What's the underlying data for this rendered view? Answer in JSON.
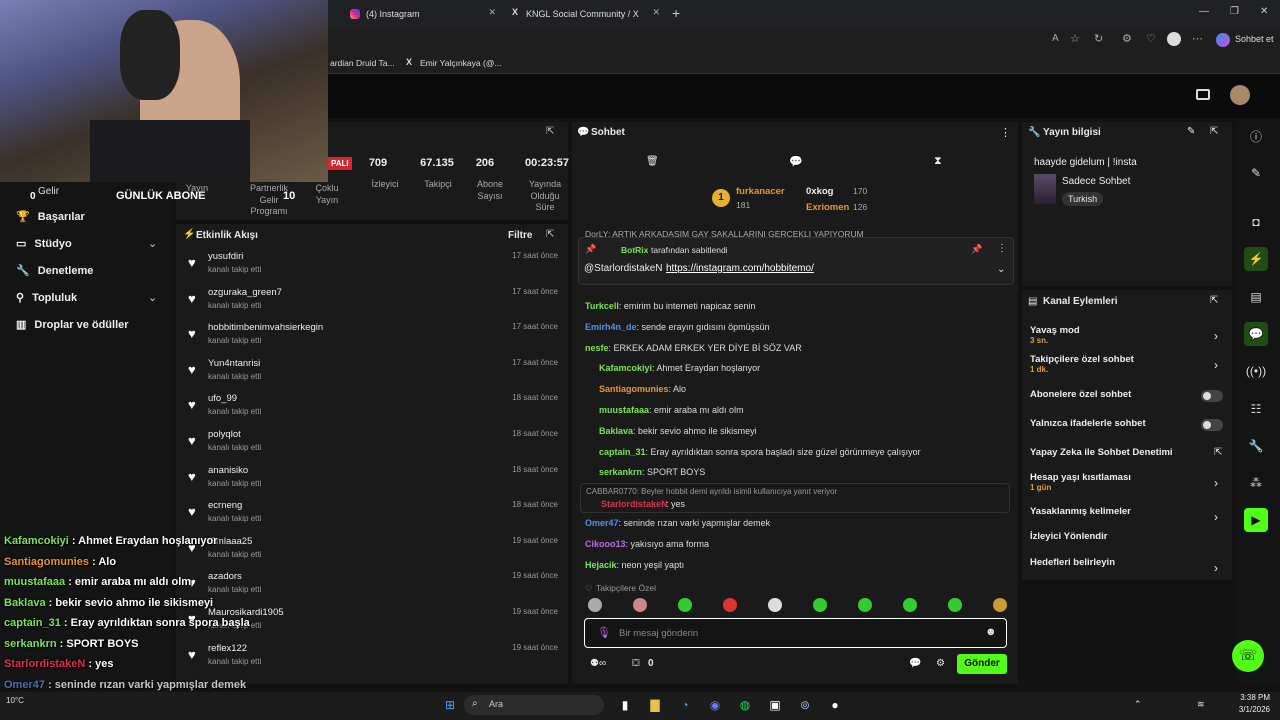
{
  "browser": {
    "tabs": [
      "(4) Instagram",
      "KNGL Social Community / X"
    ],
    "profile_label": "Sohbet et",
    "bookmarks": [
      "ardian Druid Ta...",
      "Emir Yalçınkaya (@..."
    ]
  },
  "overlay": {
    "gelir_label": "Gelir",
    "gelir_value": "0",
    "gunluk_abone": "GÜNLÜK ABONE",
    "gunluk_value": "10",
    "chat": [
      {
        "user": "Kafamcokiyi",
        "text": " : Ahmet Eraydan hoşlanıyor",
        "color": "#7be35a"
      },
      {
        "user": "Santiagomunies",
        "text": " : Alo",
        "color": "#e8962e"
      },
      {
        "user": "muustafaaa",
        "text": " : emir araba mı aldı olm",
        "color": "#7be35a"
      },
      {
        "user": "Baklava",
        "text": " : bekir sevio ahmo ile sikismeyi",
        "color": "#7be35a"
      },
      {
        "user": "captain_31",
        "text": " : Eray ayrıldıktan sonra spora başla",
        "color": "#7be35a"
      },
      {
        "user": "serkankrn",
        "text": " : SPORT BOYS",
        "color": "#7be35a"
      },
      {
        "user": "StarlordistakeN",
        "text": " : yes",
        "color": "#e0314b"
      },
      {
        "user": "Omer47",
        "text": " : seninde rızan varki yapmışlar demek",
        "color": "#5a8fe3"
      },
      {
        "user": "Cikooo13",
        "text": " : yakısıyo ama forma",
        "color": "#c06be3"
      }
    ]
  },
  "sidebar": {
    "items": [
      {
        "label": "Başarılar"
      },
      {
        "label": "Stüdyo"
      },
      {
        "label": "Denetleme"
      },
      {
        "label": "Topluluk"
      },
      {
        "label": "Droplar ve ödüller"
      }
    ]
  },
  "stats": {
    "badge": "PALI",
    "items": [
      {
        "value": "709",
        "label": "İzleyici"
      },
      {
        "value": "67.135",
        "label": "Takipçi"
      },
      {
        "value": "206",
        "label": "Abone Sayısı"
      },
      {
        "value": "00:23:57",
        "label": "Yayında Olduğu Süre"
      }
    ],
    "hidden_labels": [
      "Yayın",
      "Partnerlik Gelir Programı",
      "Çoklu Yayın"
    ]
  },
  "activity": {
    "title": "Etkinlik Akışı",
    "filter_label": "Filtre",
    "subtitle": "kanalı takip etti",
    "rows": [
      {
        "name": "yusufdiri",
        "time": "17 saat önce"
      },
      {
        "name": "ozguraka_green7",
        "time": "17 saat önce"
      },
      {
        "name": "hobbitimbenimvahsierkegin",
        "time": "17 saat önce"
      },
      {
        "name": "Yun4ntanrisi",
        "time": "17 saat önce"
      },
      {
        "name": "ufo_99",
        "time": "18 saat önce"
      },
      {
        "name": "polyqlot",
        "time": "18 saat önce"
      },
      {
        "name": "ananisiko",
        "time": "18 saat önce"
      },
      {
        "name": "ecrneng",
        "time": "18 saat önce"
      },
      {
        "name": "t3mlaaa25",
        "time": "19 saat önce"
      },
      {
        "name": "azadors",
        "time": "19 saat önce"
      },
      {
        "name": "Maurosikardi1905",
        "time": "19 saat önce"
      },
      {
        "name": "reflex122",
        "time": "19 saat önce"
      }
    ]
  },
  "chat": {
    "title": "Sohbet",
    "leaders": [
      {
        "rank": "1",
        "name": "furkanacer",
        "count": "181"
      },
      {
        "name": "0xkog",
        "count": "170"
      },
      {
        "name": "Exriomen",
        "count": "126"
      }
    ],
    "cut_top": "DorLY: ARTIK ARKADASIM GAY SAKALLARINI GERCEKLI YAPIYORUM",
    "pinned": {
      "by": "BotRix",
      "by_suffix": " tarafından sabitlendi",
      "user": "@StarlordistakeN",
      "link": "https://instagram.com/hobbitemo/"
    },
    "messages": [
      {
        "user": "Turkcell",
        "text": ": emirim bu interneti napicaz senin",
        "color": "#7be35a"
      },
      {
        "user": "Emirh4n_de",
        "text": ": sende erayın gıdısını öpmüşsün",
        "color": "#5a8fe3"
      },
      {
        "user": "nesfe",
        "text": ": ERKEK ADAM ERKEK YER DİYE Bİ SÖZ VAR",
        "color": "#7be35a"
      },
      {
        "user": "Kafamcokiyi",
        "text": ": Ahmet Eraydan hoşlanyor",
        "color": "#7be35a"
      },
      {
        "user": "Santiagomunies",
        "text": ": Alo",
        "color": "#e8962e"
      },
      {
        "user": "muustafaaa",
        "text": ": emir araba mı aldı olm",
        "color": "#7be35a"
      },
      {
        "user": "Baklava",
        "text": ": bekir sevio ahmo ile sikismeyi",
        "color": "#7be35a"
      },
      {
        "user": "captain_31",
        "text": ": Eray ayrıldıktan sonra spora başladı size güzel görünmeye çalışıyor",
        "color": "#7be35a"
      },
      {
        "user": "serkankrn",
        "text": ": SPORT BOYS",
        "color": "#7be35a"
      }
    ],
    "reply_quote": "CABBAR0770: Beyler hobbit demi ayrıldı isimli kullanıcıya yanıt veriyor",
    "reply_user": "StarlordistakeN",
    "reply_text": ": yes",
    "messages2": [
      {
        "user": "Omer47",
        "text": ": seninde rızan varki yapmışlar demek",
        "color": "#5a8fe3"
      },
      {
        "user": "Cikooo13",
        "text": ": yakısıyo ama forma",
        "color": "#c06be3"
      },
      {
        "user": "Hejacik",
        "text": ": neon yeşil yaptı",
        "color": "#7be35a"
      }
    ],
    "emote_section": "Takipçilere Özel",
    "input_placeholder": "Bir mesaj gönderin",
    "points": "0",
    "send_label": "Gönder"
  },
  "stream_info": {
    "title": "Yayın bilgisi",
    "stream_title": "haayde gidelum | !insta",
    "category": "Sadece Sohbet",
    "language": "Turkish"
  },
  "channel_actions": {
    "title": "Kanal Eylemleri",
    "items": [
      {
        "label": "Yavaş mod",
        "sub": "3 sn.",
        "control": "chevron"
      },
      {
        "label": "Takipçilere özel sohbet",
        "sub": "1 dk.",
        "control": "chevron"
      },
      {
        "label": "Abonelere özel sohbet",
        "sub": "",
        "control": "toggle"
      },
      {
        "label": "Yalnızca ifadelerle sohbet",
        "sub": "",
        "control": "toggle"
      },
      {
        "label": "Yapay Zeka ile Sohbet Denetimi",
        "sub": "",
        "control": "external"
      },
      {
        "label": "Hesap yaşı kısıtlaması",
        "sub": "1 gün",
        "control": "chevron"
      },
      {
        "label": "Yasaklanmış kelimeler",
        "sub": "",
        "control": "chevron"
      },
      {
        "label": "İzleyici Yönlendir",
        "sub": "",
        "control": "none"
      },
      {
        "label": "Hedefleri belirleyin",
        "sub": "",
        "control": "chevron"
      }
    ]
  },
  "taskbar": {
    "search": "Ara",
    "temp": "10°C",
    "time": "3:38 PM",
    "date": "3/1/2026"
  },
  "colors": {
    "accent": "#53fc18",
    "panel": "#1a1a1a",
    "bg": "#121212"
  }
}
